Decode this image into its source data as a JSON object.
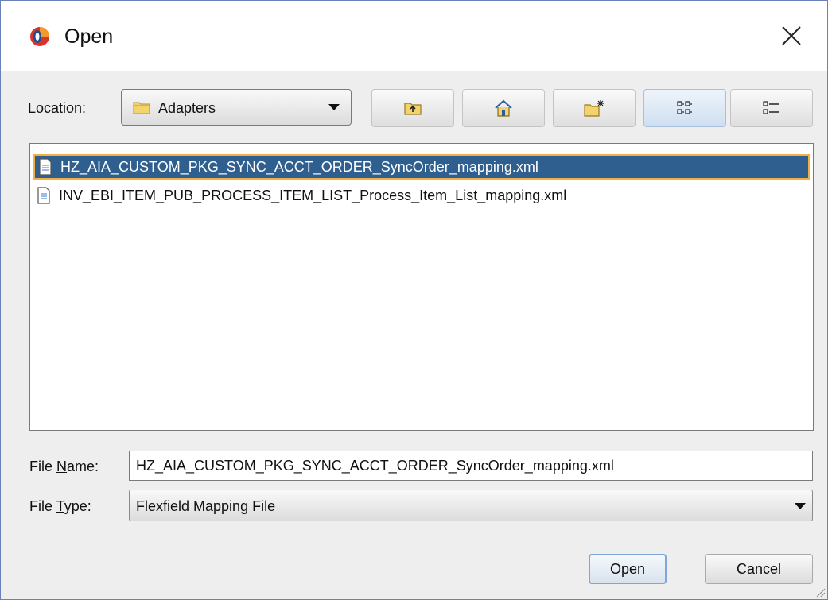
{
  "window": {
    "title": "Open"
  },
  "location": {
    "label_mnemonic": "L",
    "label_rest": "ocation:",
    "value": "Adapters"
  },
  "toolbar": {
    "buttons": [
      {
        "name": "up-one-level",
        "icon": "folder-up-icon"
      },
      {
        "name": "home",
        "icon": "home-icon"
      },
      {
        "name": "new-folder",
        "icon": "new-folder-icon"
      },
      {
        "name": "list-view",
        "icon": "list-view-icon",
        "active": true
      },
      {
        "name": "details-view",
        "icon": "details-view-icon"
      }
    ]
  },
  "files": [
    {
      "name": "HZ_AIA_CUSTOM_PKG_SYNC_ACCT_ORDER_SyncOrder_mapping.xml",
      "selected": true
    },
    {
      "name": "INV_EBI_ITEM_PUB_PROCESS_ITEM_LIST_Process_Item_List_mapping.xml",
      "selected": false
    }
  ],
  "file_name": {
    "label_pre": "File ",
    "label_mnemonic": "N",
    "label_post": "ame:",
    "value": "HZ_AIA_CUSTOM_PKG_SYNC_ACCT_ORDER_SyncOrder_mapping.xml"
  },
  "file_type": {
    "label_pre": "File ",
    "label_mnemonic": "T",
    "label_post": "ype:",
    "value": "Flexfield Mapping File"
  },
  "buttons": {
    "open_mnemonic": "O",
    "open_rest": "pen",
    "cancel": "Cancel"
  },
  "colors": {
    "selection": "#2e5f8f",
    "selection_border": "#f0b046",
    "window_border": "#6b7fb8"
  }
}
